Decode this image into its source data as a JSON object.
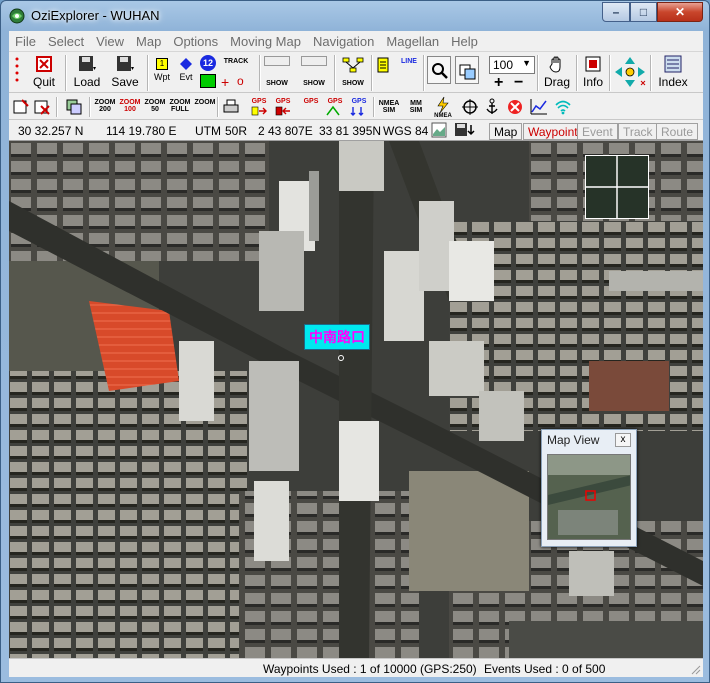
{
  "window": {
    "title": "OziExplorer - WUHAN",
    "min_glyph": "–",
    "max_glyph": "□",
    "close_glyph": "✕"
  },
  "menu": [
    "File",
    "Select",
    "View",
    "Map",
    "Options",
    "Moving Map",
    "Navigation",
    "Magellan",
    "Help"
  ],
  "toolbar": {
    "quit": "Quit",
    "load": "Load",
    "save": "Save",
    "wpt": "Wpt",
    "evt": "Evt",
    "track_label": "TRACK",
    "show": "SHOW",
    "zoom_value": "100",
    "drag": "Drag",
    "info": "Info",
    "index": "Index",
    "line": "LINE",
    "icon_12": "12"
  },
  "toolbar2": {
    "zoom200": "ZOOM\n200",
    "zoom100": "ZOOM\n100",
    "zoom50": "ZOOM\n50",
    "zoomfull": "ZOOM\nFULL",
    "zoom_plain": "ZOOM",
    "nmea_sim": "NMEA\nSIM",
    "mm_sim": "MM\nSIM",
    "nmea": "NMEA",
    "gps": "GPS"
  },
  "coords": {
    "lat": "30 32.257 N",
    "lon": "114 19.780 E",
    "utm": "UTM",
    "zone": "50R",
    "easting": "2 43 807E",
    "northing": "33 81 395N",
    "datum": "WGS 84"
  },
  "tabs": [
    {
      "label": "Map",
      "color": "#000000"
    },
    {
      "label": "Waypoint",
      "color": "#cc0000"
    },
    {
      "label": "Event",
      "color": "#9a9a9a"
    },
    {
      "label": "Track",
      "color": "#9a9a9a"
    },
    {
      "label": "Route",
      "color": "#9a9a9a"
    }
  ],
  "map": {
    "waypoint_label": "中南路口"
  },
  "mapview": {
    "title": "Map View",
    "close": "x"
  },
  "status": {
    "waypoints": "Waypoints Used : 1 of 10000  (GPS:250)",
    "events": "Events Used : 0 of 500"
  },
  "colors": {
    "accent": "#0000cc",
    "waypoint_bg": "#00e8ef",
    "waypoint_text": "#ff00ff"
  }
}
